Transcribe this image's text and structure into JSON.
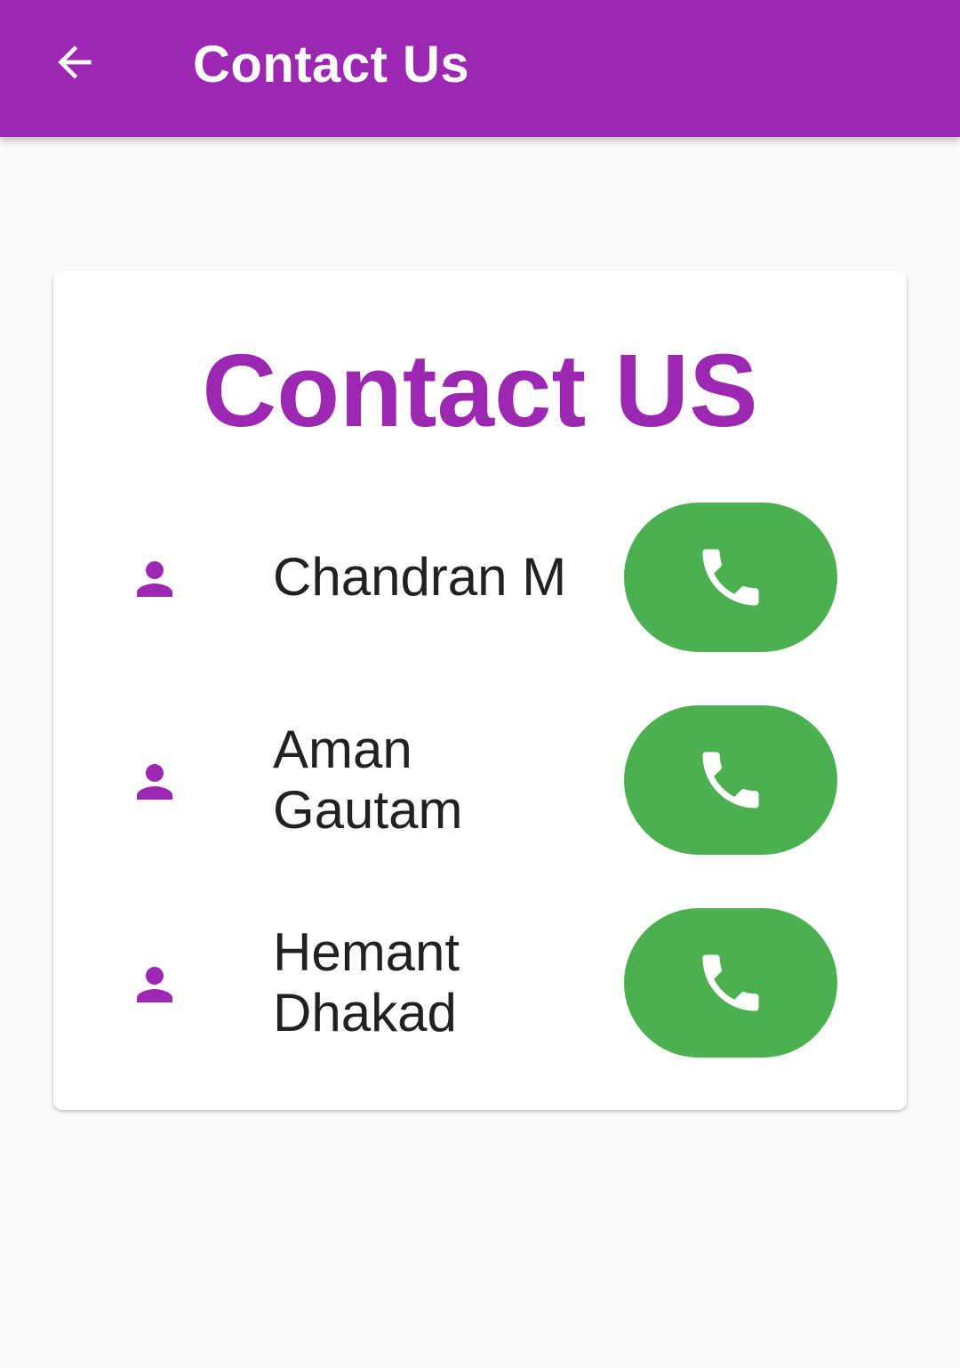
{
  "appbar": {
    "title": "Contact Us",
    "background_color": "#9c27b0",
    "back_icon": "arrow-back-icon"
  },
  "card": {
    "title": "Contact US",
    "title_color": "#9c27b0"
  },
  "contacts": [
    {
      "name": "Chandran M",
      "person_icon": "person-icon",
      "call_icon": "phone-icon"
    },
    {
      "name": "Aman Gautam",
      "person_icon": "person-icon",
      "call_icon": "phone-icon"
    },
    {
      "name": "Hemant Dhakad",
      "person_icon": "person-icon",
      "call_icon": "phone-icon"
    }
  ],
  "colors": {
    "accent": "#9c27b0",
    "call_button": "#4caf50",
    "text": "#212121",
    "background": "#fafafa"
  }
}
